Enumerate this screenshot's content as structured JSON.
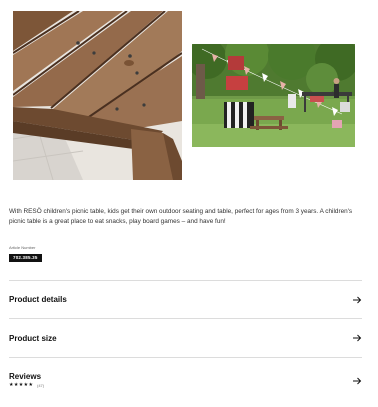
{
  "description": "With RESÖ children's picnic table, kids get their own outdoor seating and table, perfect for ages from 3 years. A children's picnic table is a great place to eat snacks, play board games – and have fun!",
  "article": {
    "label": "Article Number",
    "number": "702.385.35"
  },
  "accordion": {
    "product_details": "Product details",
    "product_size": "Product size",
    "reviews": "Reviews",
    "rating_stars": "★★★★★",
    "review_count": "(47)"
  },
  "icons": {
    "arrow": "arrow-right-icon"
  },
  "colors": {
    "text": "#111111",
    "divider": "#dcdcdc",
    "wood": "#8a6243",
    "grass": "#5f8a3a"
  }
}
